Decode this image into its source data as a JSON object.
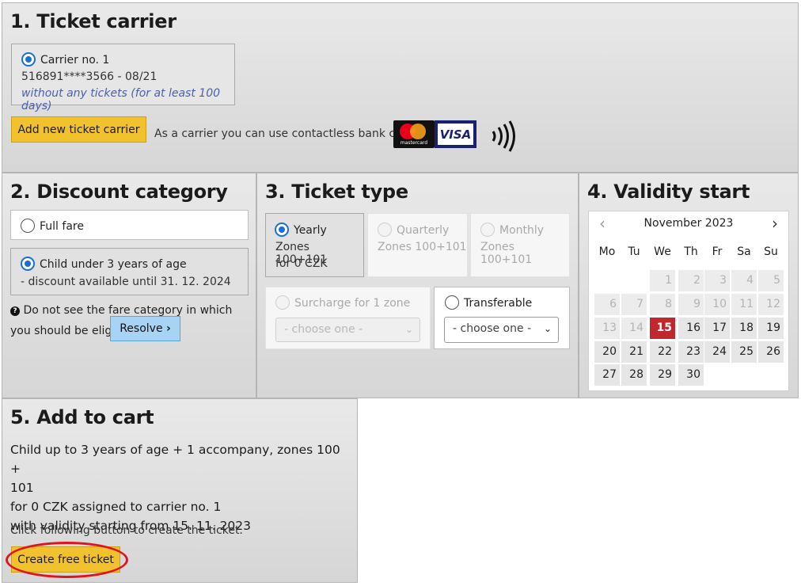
{
  "section1": {
    "title": "1. Ticket carrier",
    "carrier": {
      "name": "Carrier no. 1",
      "card_number": "516891****3566 - 08/21",
      "note": "without any tickets (for at least 100 days)"
    },
    "add_button": "Add new ticket carrier",
    "contactless_text": "As a carrier you can use contactless bank card",
    "mastercard_label": "mastercard",
    "visa_label": "VISA"
  },
  "section2": {
    "title": "2. Discount category",
    "options": [
      {
        "label": "Full fare",
        "selected": false
      },
      {
        "label": "Child under 3 years of age",
        "detail": "- discount available until 31. 12. 2024",
        "selected": true
      }
    ],
    "help_text": "Do not see the fare category in which you should be eligible?",
    "resolve_button": "Resolve"
  },
  "section3": {
    "title": "3. Ticket type",
    "types": [
      {
        "label": "Yearly",
        "zones": "Zones 100+101",
        "price": "for 0 CZK",
        "selected": true,
        "disabled": false
      },
      {
        "label": "Quarterly",
        "zones": "Zones 100+101",
        "selected": false,
        "disabled": true
      },
      {
        "label": "Monthly",
        "zones": "Zones 100+101",
        "selected": false,
        "disabled": true
      }
    ],
    "surcharge": {
      "label": "Surcharge for 1 zone",
      "select": "- choose one -"
    },
    "transferable": {
      "label": "Transferable",
      "select": "- choose one -"
    }
  },
  "section4": {
    "title": "4. Validity start",
    "calendar_title": "November 2023",
    "prev": "‹",
    "next": "›",
    "weekdays": [
      "Mo",
      "Tu",
      "We",
      "Th",
      "Fr",
      "Sa",
      "Su"
    ],
    "first_weekday_index": 2,
    "days_in_month": 30,
    "today": 15
  },
  "section5": {
    "title": "5. Add to cart",
    "summary_line1": "Child up to 3 years of age + 1 accompany, zones 100 +",
    "summary_line2": "101",
    "summary_line3": "for 0 CZK assigned to carrier no. 1",
    "summary_line4": "with validity starting from 15. 11. 2023",
    "instruction": "Click following button to create the ticket.",
    "create_button": "Create free ticket"
  },
  "colors": {
    "accent_yellow": "#f2c12e",
    "selected_radio": "#1a6fd1",
    "today_red": "#c0282d",
    "resolve_blue": "#a7d4f5",
    "highlight_ellipse": "#e0141e"
  }
}
